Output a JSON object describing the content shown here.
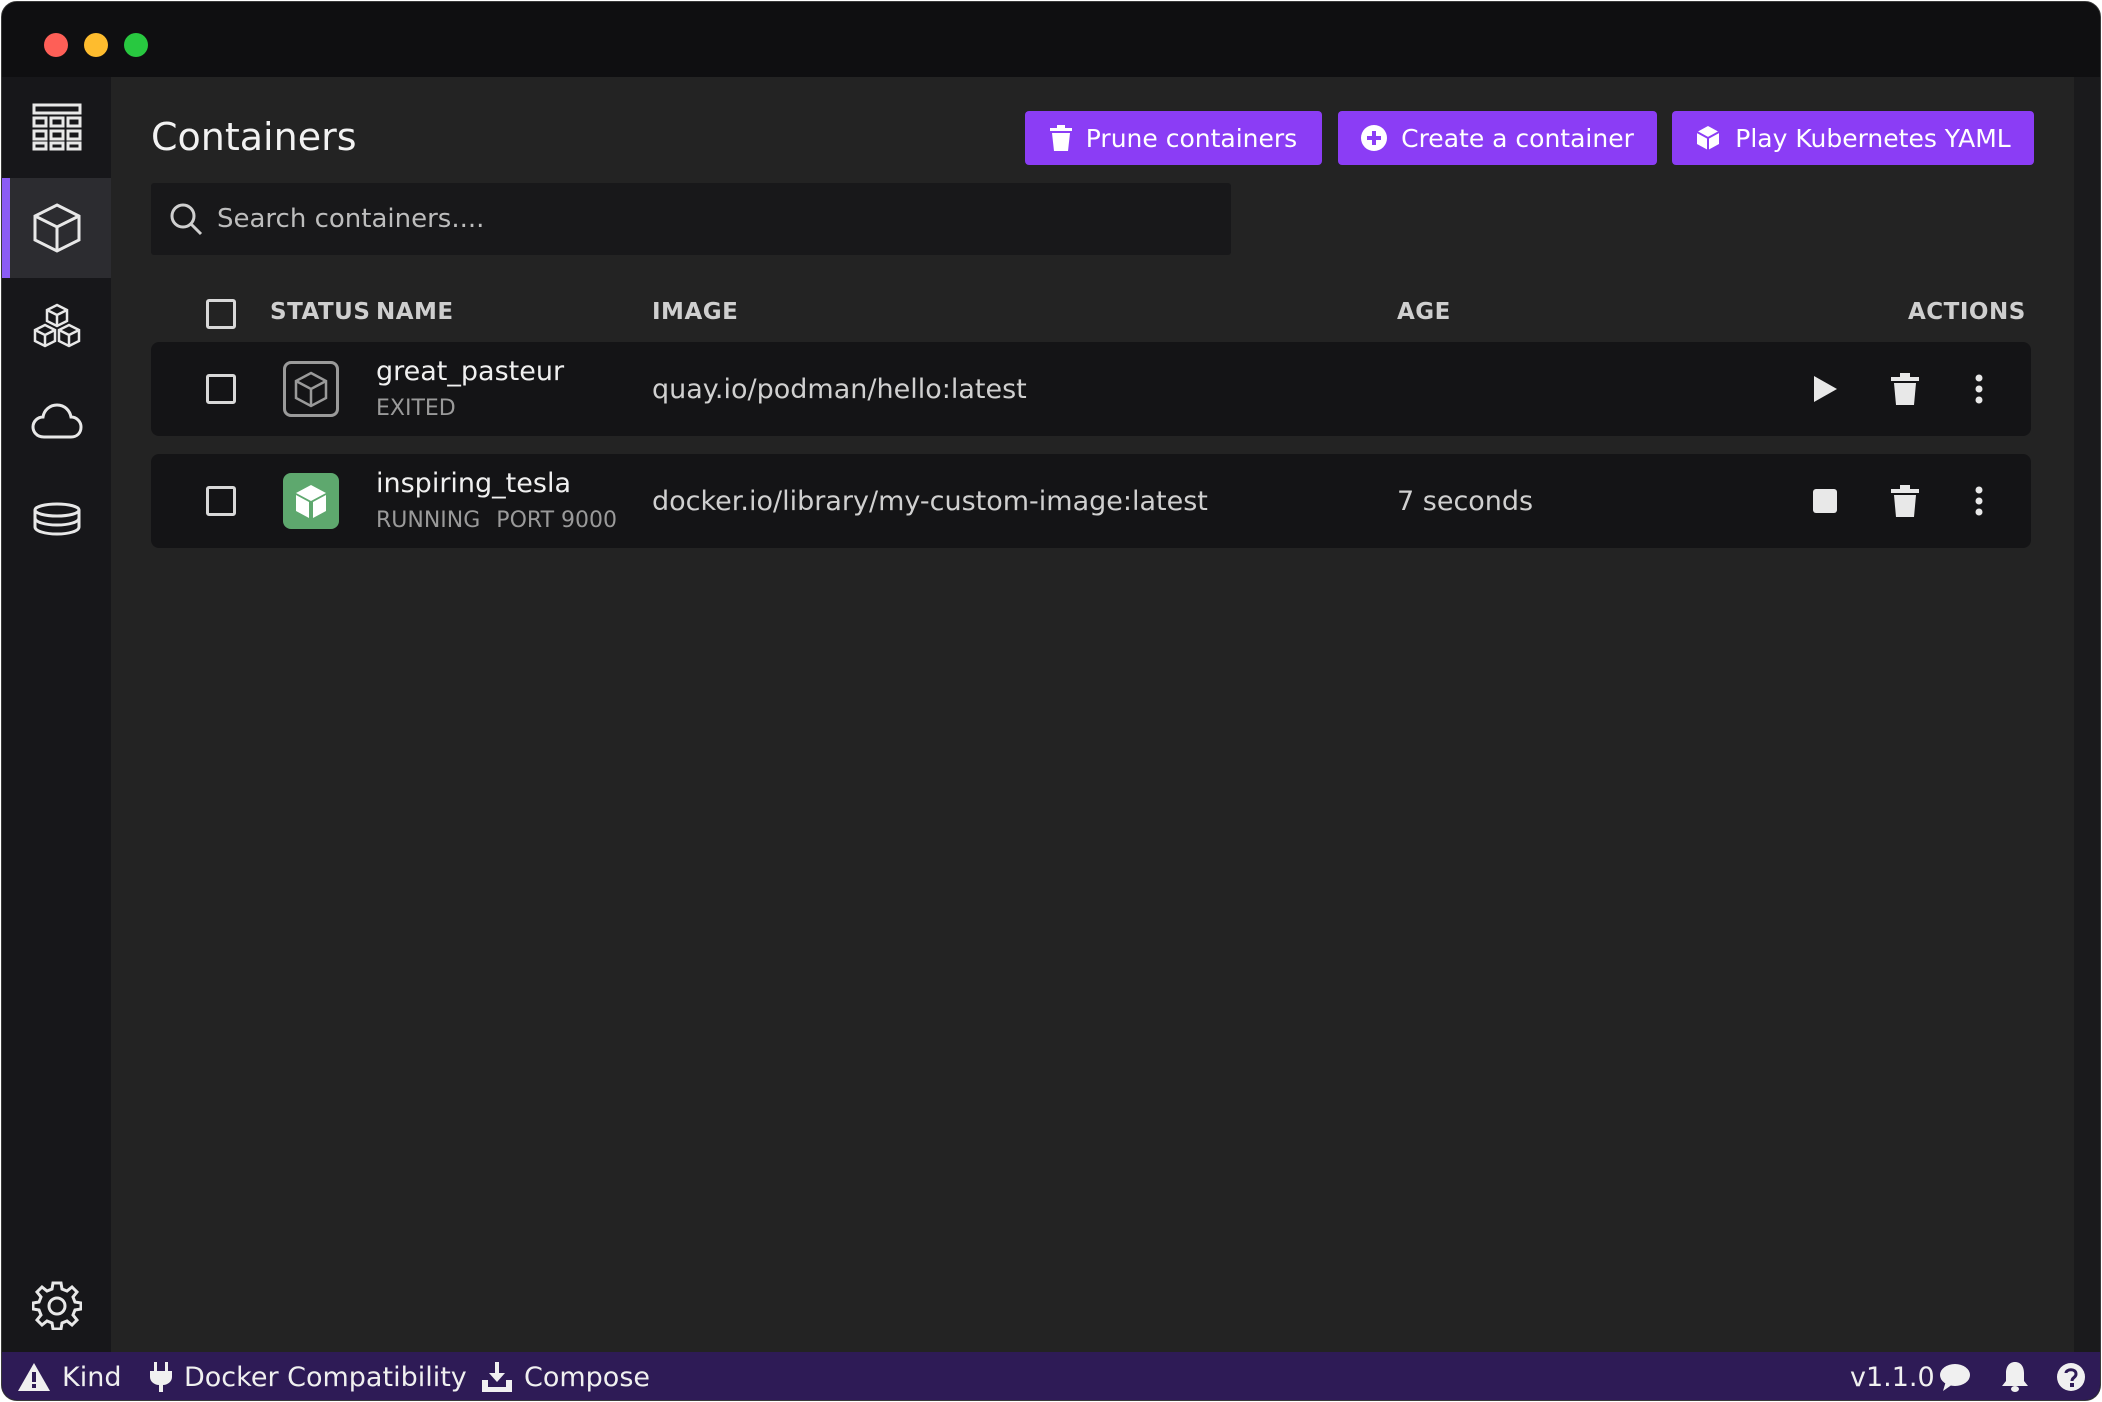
{
  "window": {
    "controls": [
      "close",
      "minimize",
      "maximize"
    ]
  },
  "sidebar": {
    "items": [
      {
        "name": "dashboard",
        "icon": "dashboard-icon",
        "active": false
      },
      {
        "name": "containers",
        "icon": "cube-icon",
        "active": true
      },
      {
        "name": "pods",
        "icon": "pods-icon",
        "active": false
      },
      {
        "name": "images",
        "icon": "cloud-icon",
        "active": false
      },
      {
        "name": "volumes",
        "icon": "database-icon",
        "active": false
      }
    ],
    "settings_icon": "gear-icon"
  },
  "header": {
    "title": "Containers",
    "buttons": {
      "prune": "Prune containers",
      "create": "Create a container",
      "play": "Play Kubernetes YAML"
    }
  },
  "search": {
    "placeholder": "Search containers...."
  },
  "table": {
    "columns": {
      "status": "STATUS",
      "name": "NAME",
      "image": "IMAGE",
      "age": "AGE",
      "actions": "ACTIONS"
    },
    "rows": [
      {
        "name": "great_pasteur",
        "state": "EXITED",
        "port": "",
        "image": "quay.io/podman/hello:latest",
        "age": "",
        "primary_action": "play-icon"
      },
      {
        "name": "inspiring_tesla",
        "state": "RUNNING",
        "port": "PORT 9000",
        "image": "docker.io/library/my-custom-image:latest",
        "age": "7 seconds",
        "primary_action": "stop-icon"
      }
    ]
  },
  "statusbar": {
    "kind": "Kind",
    "docker": "Docker Compatibility",
    "compose": "Compose",
    "version": "v1.1.0"
  },
  "colors": {
    "accent": "#8b3df5",
    "running": "#5ea86e",
    "statusbar": "#2e1b56"
  }
}
